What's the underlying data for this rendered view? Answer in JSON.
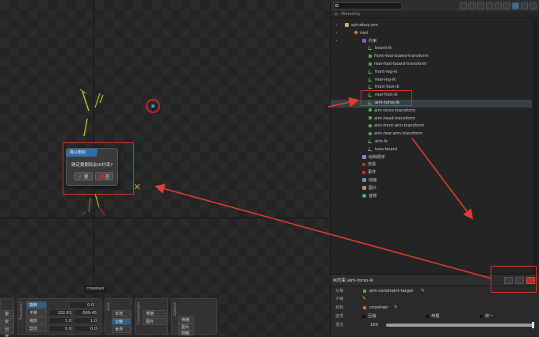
{
  "viewport": {
    "crosshair_label": "crosshair"
  },
  "dialog": {
    "title": "确认删除",
    "message": "确定要删除此IK约束?",
    "yes_label": "是",
    "no_label": "否"
  },
  "tools": {
    "pose_buttons": [
      "姿势",
      "权重",
      "创建"
    ],
    "transform_label": "Transform",
    "transform_rows": [
      {
        "label": "旋转",
        "value": "0.0"
      },
      {
        "label": "平移",
        "x": "102.83",
        "y": "-569.45"
      },
      {
        "label": "缩放",
        "x": "1.0",
        "y": "1.0"
      },
      {
        "label": "剪切",
        "x": "0.0",
        "y": "0.0"
      }
    ],
    "axes_label": "Axes",
    "axes_buttons": [
      "本地",
      "父级",
      "世界"
    ],
    "compensate_label": "Compensate",
    "compensate_buttons": [
      "骨骼",
      "图片"
    ],
    "options_label": "Options",
    "options_items": [
      "骨骼",
      "图片",
      "网格"
    ]
  },
  "panel": {
    "search_placeholder": "",
    "hierarchy_label": "Hierarchy",
    "tree": [
      {
        "label": "spineboy-pro",
        "icon": "skeleton-icon",
        "indent": 0
      },
      {
        "label": "root",
        "icon": "bone-icon",
        "indent": 1
      },
      {
        "label": "约束",
        "icon": "folder-icon",
        "indent": 2
      },
      {
        "label": "board-ik",
        "icon": "ik-icon",
        "indent": 3
      },
      {
        "label": "front-foot-board-transform",
        "icon": "transform-icon",
        "indent": 3
      },
      {
        "label": "rear-foot-board-transform",
        "icon": "transform-icon",
        "indent": 3
      },
      {
        "label": "front-leg-ik",
        "icon": "ik-icon",
        "indent": 3
      },
      {
        "label": "rear-leg-ik",
        "icon": "ik-icon",
        "indent": 3
      },
      {
        "label": "front-foot-ik",
        "icon": "ik-icon",
        "indent": 3
      },
      {
        "label": "rear-foot-ik",
        "icon": "ik-icon",
        "indent": 3
      },
      {
        "label": "aim-torso-ik",
        "icon": "ik-icon",
        "indent": 3,
        "selected": true
      },
      {
        "label": "aim-torso-transform",
        "icon": "transform-icon",
        "indent": 3
      },
      {
        "label": "aim-head-transform",
        "icon": "transform-icon",
        "indent": 3
      },
      {
        "label": "aim-front-arm-transform",
        "icon": "transform-icon",
        "indent": 3
      },
      {
        "label": "aim-rear-arm-transform",
        "icon": "transform-icon",
        "indent": 3
      },
      {
        "label": "aim-ik",
        "icon": "ik-icon",
        "indent": 3
      },
      {
        "label": "toes-board",
        "icon": "ik-icon",
        "indent": 3
      },
      {
        "label": "绘制顺序",
        "icon": "draw-order-icon",
        "indent": 2
      },
      {
        "label": "皮肤",
        "icon": "skin-icon",
        "indent": 2
      },
      {
        "label": "事件",
        "icon": "event-icon",
        "indent": 2
      },
      {
        "label": "动画",
        "icon": "animation-icon",
        "indent": 2
      },
      {
        "label": "图片",
        "icon": "image-icon",
        "indent": 2
      },
      {
        "label": "音频",
        "icon": "audio-icon",
        "indent": 2
      }
    ]
  },
  "props": {
    "header": "IK约束 aim-torso-ik",
    "parent_label": "父级",
    "parent_value": "aim-constraint-target",
    "child_label": "子级",
    "target_label": "目标",
    "target_value": "crosshair",
    "options_label": "选项",
    "option_1": "压缩",
    "option_2": "伸展",
    "option_3": "统一",
    "mix_label": "混合",
    "mix_value": "100",
    "mix_fraction": 1.0
  },
  "colors": {
    "annotation_red": "#d0342c",
    "accent_blue": "#2d6fa8",
    "selection": "#3a3f44"
  }
}
